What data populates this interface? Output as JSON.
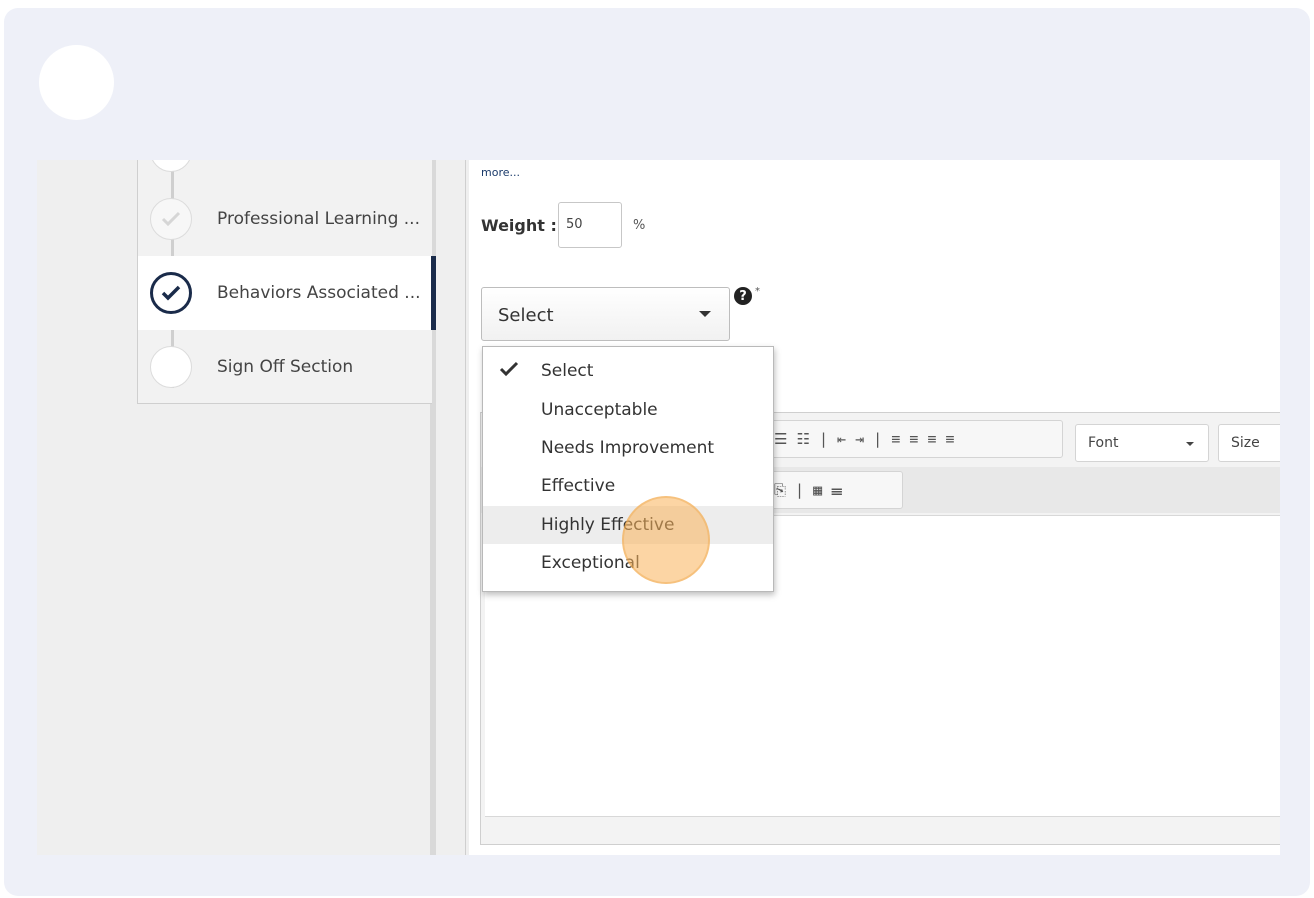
{
  "steps": [
    {
      "label": "Professional Learning ...",
      "state": "done"
    },
    {
      "label": "Behaviors Associated ...",
      "state": "current"
    },
    {
      "label": "Sign Off Section",
      "state": "pending"
    }
  ],
  "form": {
    "more_link": "more...",
    "weight_label": "Weight :",
    "weight_value": "50",
    "weight_unit": "%",
    "rating_selected": "Select",
    "help_icon": "?",
    "required_marker": "*"
  },
  "dropdown": {
    "options": [
      "Select",
      "Unacceptable",
      "Needs Improvement",
      "Effective",
      "Highly Effective",
      "Exceptional"
    ],
    "checked_index": 0,
    "hover_index": 4
  },
  "editor": {
    "font_label": "Font",
    "size_label": "Size",
    "row1_tools": "☰ ☷ | ⇤ ⇥ | ≡ ≡ ≡ ≡",
    "row2_tools": "⎘ | ▦ ☰"
  },
  "colors": {
    "frame_bg": "#eef0f8",
    "active_step": "#1a2b4a",
    "click_highlight": "#fab25a"
  }
}
